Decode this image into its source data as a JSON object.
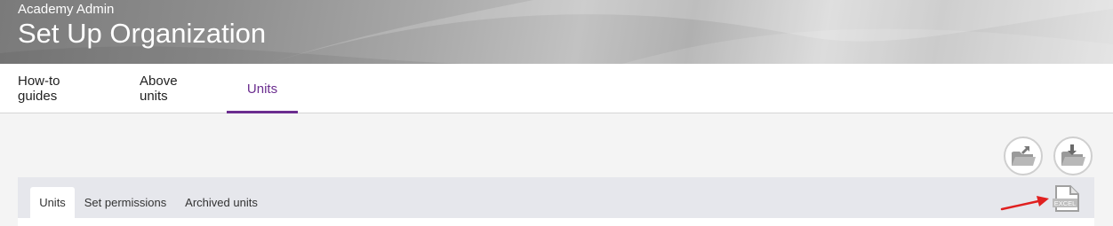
{
  "header": {
    "subtitle": "Academy Admin",
    "title": "Set Up Organization"
  },
  "main_tabs": [
    {
      "label": "How-to guides",
      "active": false
    },
    {
      "label": "Above units",
      "active": false
    },
    {
      "label": "Units",
      "active": true
    }
  ],
  "actions": {
    "upload_icon": "folder-upload-icon",
    "download_icon": "folder-download-icon",
    "export_icon": "excel-export-icon",
    "export_label": "EXCEL"
  },
  "sub_tabs": [
    {
      "label": "Units",
      "active": true
    },
    {
      "label": "Set permissions",
      "active": false
    },
    {
      "label": "Archived units",
      "active": false
    }
  ],
  "colors": {
    "accent": "#6b2d8f",
    "annotation_arrow": "#e02020"
  }
}
